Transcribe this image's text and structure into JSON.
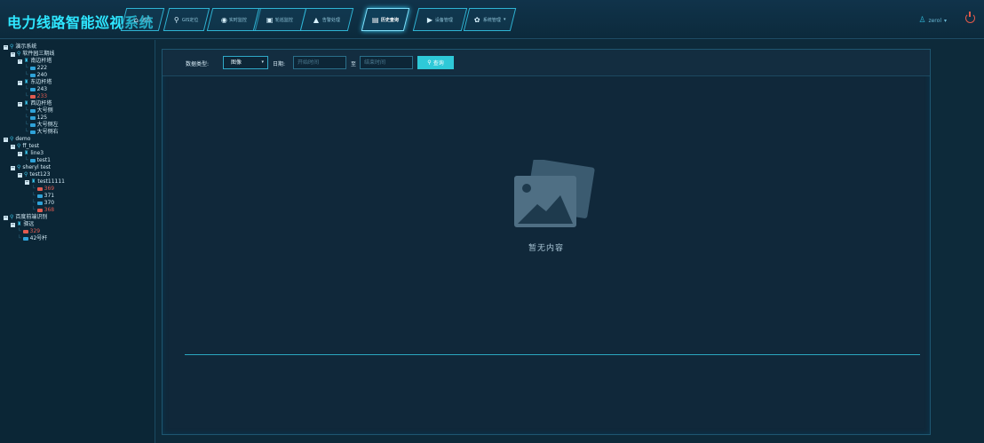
{
  "app": {
    "title": "电力线路智能巡视系统"
  },
  "nav": {
    "items": [
      {
        "label": "首页",
        "icon": "home-icon",
        "glyph": "⌂",
        "active": false
      },
      {
        "label": "GIS定位",
        "icon": "pin-icon",
        "glyph": "⚲",
        "active": false
      },
      {
        "label": "实时监控",
        "icon": "monitor-icon",
        "glyph": "◉",
        "active": false
      },
      {
        "label": "轮巡监控",
        "icon": "camera-icon",
        "glyph": "▣",
        "active": false
      },
      {
        "label": "告警处理",
        "icon": "warning-icon",
        "glyph": "▲",
        "active": false
      },
      {
        "label": "历史查询",
        "icon": "history-icon",
        "glyph": "▤",
        "active": true
      },
      {
        "label": "设备管理",
        "icon": "device-icon",
        "glyph": "▶",
        "active": false
      },
      {
        "label": "系统管理",
        "icon": "gear-icon",
        "glyph": "✿",
        "active": false,
        "dropdown": "▾"
      }
    ]
  },
  "user": {
    "name": "zerol",
    "caret": "▾",
    "icon": "user-icon"
  },
  "tree": {
    "nodes": [
      {
        "text": "演示系统",
        "depth": 0,
        "kind": "pin",
        "toggle": "−"
      },
      {
        "text": "软件园三期线",
        "depth": 1,
        "kind": "pin",
        "toggle": "−"
      },
      {
        "text": "南边杆塔",
        "depth": 2,
        "kind": "tower",
        "toggle": "−"
      },
      {
        "text": "222",
        "depth": 3,
        "kind": "cam",
        "color": "#2fa2d8"
      },
      {
        "text": "240",
        "depth": 3,
        "kind": "cam",
        "color": "#2fa2d8"
      },
      {
        "text": "东边杆塔",
        "depth": 2,
        "kind": "tower",
        "toggle": "−"
      },
      {
        "text": "243",
        "depth": 3,
        "kind": "cam",
        "color": "#2fa2d8"
      },
      {
        "text": "233",
        "depth": 3,
        "kind": "cam",
        "color": "#e25b50",
        "red": true
      },
      {
        "text": "西边杆塔",
        "depth": 2,
        "kind": "tower",
        "toggle": "−"
      },
      {
        "text": "大号侧",
        "depth": 3,
        "kind": "cam",
        "color": "#2fa2d8"
      },
      {
        "text": "125",
        "depth": 3,
        "kind": "cam",
        "color": "#2fa2d8"
      },
      {
        "text": "大号侧左",
        "depth": 3,
        "kind": "cam",
        "color": "#2fa2d8"
      },
      {
        "text": "大号侧右",
        "depth": 3,
        "kind": "cam",
        "color": "#2fa2d8"
      },
      {
        "text": "demo",
        "depth": 0,
        "kind": "pin",
        "toggle": "−"
      },
      {
        "text": "ff_test",
        "depth": 1,
        "kind": "pin",
        "toggle": "−"
      },
      {
        "text": "line3",
        "depth": 2,
        "kind": "tower",
        "toggle": "−"
      },
      {
        "text": "test1",
        "depth": 3,
        "kind": "cam",
        "color": "#2fa2d8"
      },
      {
        "text": "sheryl test",
        "depth": 1,
        "kind": "pin",
        "toggle": "−"
      },
      {
        "text": "test123",
        "depth": 2,
        "kind": "pin",
        "toggle": "−"
      },
      {
        "text": "test11111",
        "depth": 3,
        "kind": "tower",
        "toggle": "−"
      },
      {
        "text": "369",
        "depth": 4,
        "kind": "cam",
        "color": "#e25b50",
        "red": true
      },
      {
        "text": "371",
        "depth": 4,
        "kind": "cam",
        "color": "#2fa2d8"
      },
      {
        "text": "370",
        "depth": 4,
        "kind": "cam",
        "color": "#2fa2d8"
      },
      {
        "text": "368",
        "depth": 4,
        "kind": "cam",
        "color": "#e25b50",
        "red": true
      },
      {
        "text": "百度前端识别",
        "depth": 0,
        "kind": "pin",
        "toggle": "−"
      },
      {
        "text": "驿远",
        "depth": 1,
        "kind": "tower",
        "toggle": "−"
      },
      {
        "text": "329",
        "depth": 2,
        "kind": "cam",
        "color": "#e25b50",
        "red": true
      },
      {
        "text": "42号杆",
        "depth": 2,
        "kind": "cam",
        "color": "#2fa2d8"
      }
    ]
  },
  "filter": {
    "data_type_label": "数据类型:",
    "data_type_value": "图像",
    "date_label": "日期:",
    "start_placeholder": "开始时间",
    "to_label": "至",
    "end_placeholder": "结束时间",
    "query_label": "查询",
    "query_icon": "⚲",
    "select_caret": "▾"
  },
  "empty": {
    "text": "暂无内容"
  },
  "colors": {
    "accent": "#2ee6ff",
    "button": "#2ec9d8",
    "alert": "#e25b50",
    "background": "#0d2a3a"
  }
}
